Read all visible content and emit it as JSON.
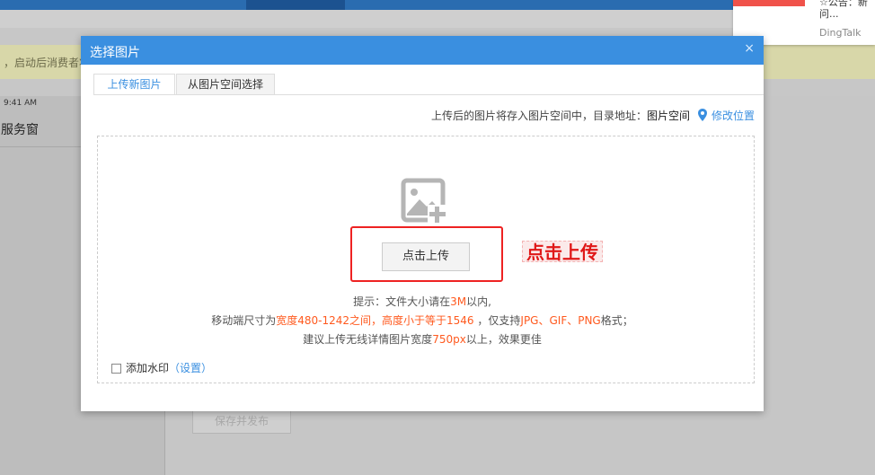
{
  "background": {
    "notice_text": "，启动后消费者将",
    "time": "9:41 AM",
    "panel_title": "服务窗",
    "save_button": "保存并发布"
  },
  "notification": {
    "message_line1": "☆公告：新",
    "message_line2": "问...",
    "source": "DingTalk"
  },
  "dialog": {
    "title": "选择图片",
    "close_label": "×",
    "tabs": [
      {
        "label": "上传新图片"
      },
      {
        "label": "从图片空间选择"
      }
    ],
    "info_prefix": "上传后的图片将存入图片空间中，目录地址：",
    "info_dir": "图片空间",
    "info_link": "修改位置",
    "upload_button": "点击上传",
    "annotation": "点击上传",
    "hint1": {
      "a": "提示：文件大小请在",
      "b": "3M",
      "c": "以内,"
    },
    "hint2": {
      "a": "移动端尺寸为",
      "b": "宽度480-1242之间，高度小于等于1546",
      "c": " ，仅支持",
      "d": "JPG、GIF、PNG",
      "e": "格式；"
    },
    "hint3": {
      "a": "建议上传无线详情图片宽度",
      "b": "750px",
      "c": "以上，效果更佳"
    },
    "watermark": {
      "label": "添加水印",
      "paren_open": "（",
      "settings": "设置",
      "paren_close": "）"
    }
  },
  "colors": {
    "accent": "#3a8fe0",
    "highlight": "#ff5a1f",
    "annotation_red": "#e01818"
  }
}
